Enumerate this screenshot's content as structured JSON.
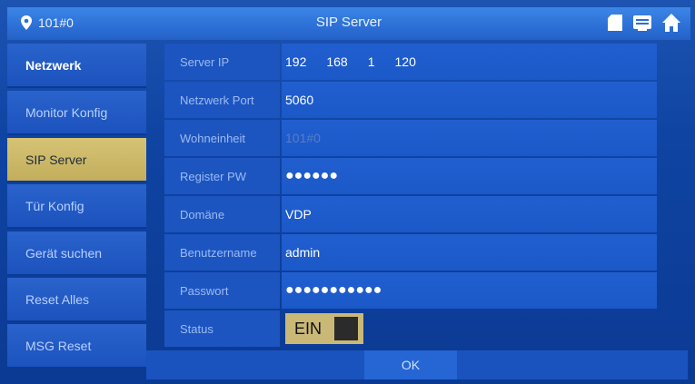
{
  "header": {
    "location": "101#0",
    "title": "SIP Server",
    "icons": [
      "sd-card-icon",
      "message-icon",
      "home-icon"
    ]
  },
  "sidebar": {
    "items": [
      {
        "label": "Netzwerk"
      },
      {
        "label": "Monitor Konfig"
      },
      {
        "label": "SIP Server"
      },
      {
        "label": "Tür Konfig"
      },
      {
        "label": "Gerät suchen"
      },
      {
        "label": "Reset Alles"
      },
      {
        "label": "MSG Reset"
      }
    ],
    "active": "SIP Server"
  },
  "form": {
    "server_ip": {
      "label": "Server IP",
      "octets": [
        "192",
        "168",
        "1",
        "120"
      ]
    },
    "netzwerk_port": {
      "label": "Netzwerk Port",
      "value": "5060"
    },
    "wohneinheit": {
      "label": "Wohneinheit",
      "value": "101#0"
    },
    "register_pw": {
      "label": "Register PW",
      "value": "●●●●●●"
    },
    "domaene": {
      "label": "Domäne",
      "value": "VDP"
    },
    "benutzername": {
      "label": "Benutzername",
      "value": "admin"
    },
    "passwort": {
      "label": "Passwort",
      "value": "●●●●●●●●●●●"
    },
    "status": {
      "label": "Status",
      "value": "EIN"
    }
  },
  "footer": {
    "ok_label": "OK"
  },
  "colors": {
    "background": "#0b3a93",
    "topbar": "#2c6fd6",
    "active_item": "#d6c374",
    "toggle": "#c9b876"
  }
}
